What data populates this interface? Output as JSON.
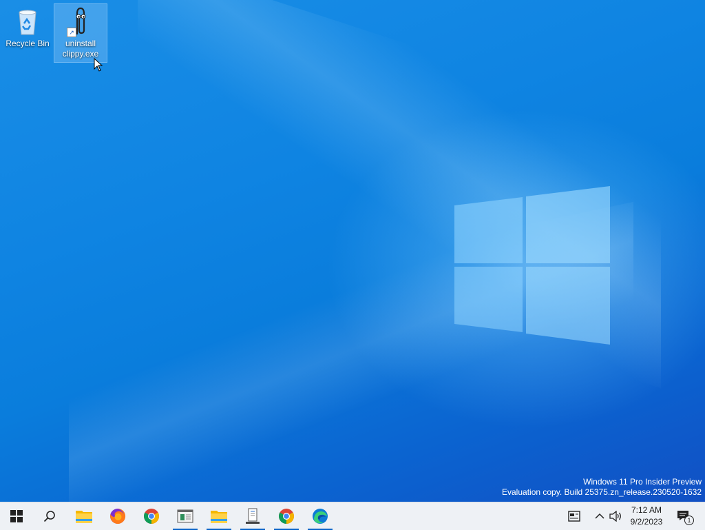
{
  "desktop": {
    "icons": [
      {
        "label": "Recycle Bin",
        "icon": "recycle-bin-icon"
      },
      {
        "label_line1": "uninstall",
        "label_line2": "clippy.exe",
        "icon": "paperclip-icon"
      }
    ],
    "watermark": {
      "line1": "Windows 11 Pro Insider Preview",
      "line2": "Evaluation copy. Build 25375.zn_release.230520-1632"
    }
  },
  "taskbar": {
    "buttons": [
      {
        "icon": "windows-start-icon"
      },
      {
        "icon": "search-icon"
      },
      {
        "icon": "file-explorer-icon"
      },
      {
        "icon": "firefox-icon"
      },
      {
        "icon": "chrome-icon"
      },
      {
        "icon": "app-window-icon",
        "running": true
      },
      {
        "icon": "file-explorer-icon",
        "running": true
      },
      {
        "icon": "document-app-icon",
        "running": true
      },
      {
        "icon": "chrome-icon",
        "running": true
      },
      {
        "icon": "edge-icon",
        "running": true
      }
    ],
    "tray": {
      "news_icon": "news-widget-icon",
      "chevron_icon": "chevron-up-icon",
      "volume_icon": "volume-icon",
      "time": "7:12 AM",
      "date": "9/2/2023",
      "notification_icon": "notification-icon",
      "notification_count": "1"
    }
  },
  "colors": {
    "accent": "#0a64c8",
    "desktop": "#0f84e2",
    "taskbar": "#eef1f5"
  }
}
